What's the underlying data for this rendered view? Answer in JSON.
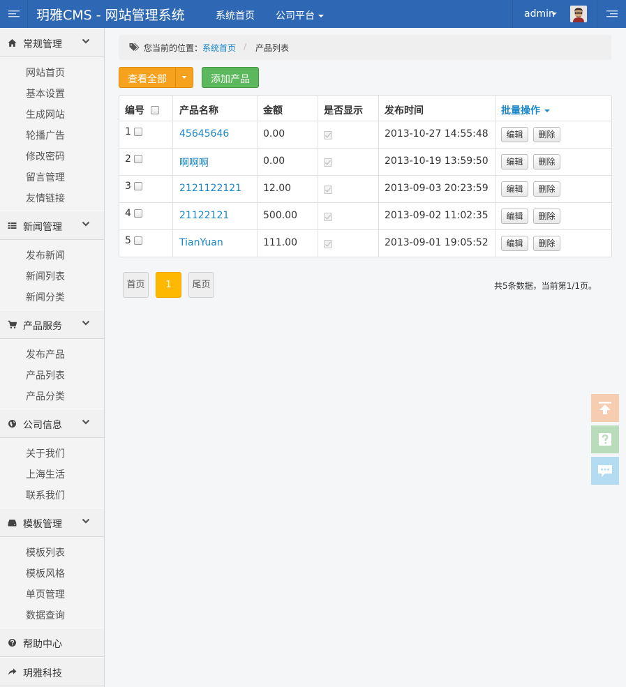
{
  "header": {
    "brand": "玥雅CMS - 网站管理系统",
    "nav_home": "系统首页",
    "nav_company": "公司平台",
    "user_name": "admin"
  },
  "sidebar": {
    "groups": [
      {
        "label": "常规管理",
        "icon": "home-icon",
        "items": [
          "网站首页",
          "基本设置",
          "生成网站",
          "轮播广告",
          "修改密码",
          "留言管理",
          "友情链接"
        ]
      },
      {
        "label": "新闻管理",
        "icon": "list-icon",
        "items": [
          "发布新闻",
          "新闻列表",
          "新闻分类"
        ]
      },
      {
        "label": "产品服务",
        "icon": "cart-icon",
        "items": [
          "发布产品",
          "产品列表",
          "产品分类"
        ]
      },
      {
        "label": "公司信息",
        "icon": "globe-icon",
        "items": [
          "关于我们",
          "上海生活",
          "联系我们"
        ]
      },
      {
        "label": "模板管理",
        "icon": "hdd-icon",
        "items": [
          "模板列表",
          "模板风格",
          "单页管理",
          "数据查询"
        ]
      },
      {
        "label": "帮助中心",
        "icon": "question-icon",
        "items": []
      },
      {
        "label": "玥雅科技",
        "icon": "share-icon",
        "items": []
      }
    ]
  },
  "breadcrumb": {
    "lead": "您当前的位置：",
    "home": "系统首页",
    "separator": "/",
    "current": "产品列表"
  },
  "toolbar": {
    "view_all": "查看全部",
    "add_product": "添加产品"
  },
  "table": {
    "headers": {
      "id": "编号",
      "name": "产品名称",
      "amount": "金额",
      "visible": "是否显示",
      "time": "发布时间",
      "batch": "批量操作"
    },
    "rows": [
      {
        "id": "1",
        "name": "45645646",
        "amount": "0.00",
        "visible": true,
        "time": "2013-10-27 14:55:48",
        "edit": "编辑",
        "delete": "删除"
      },
      {
        "id": "2",
        "name": "啊啊啊",
        "amount": "0.00",
        "visible": true,
        "time": "2013-10-19 13:59:50",
        "edit": "编辑",
        "delete": "删除"
      },
      {
        "id": "3",
        "name": "2121122121",
        "amount": "12.00",
        "visible": true,
        "time": "2013-09-03 20:23:59",
        "edit": "编辑",
        "delete": "删除"
      },
      {
        "id": "4",
        "name": "21122121",
        "amount": "500.00",
        "visible": true,
        "time": "2013-09-02 11:02:35",
        "edit": "编辑",
        "delete": "删除"
      },
      {
        "id": "5",
        "name": "TianYuan",
        "amount": "111.00",
        "visible": true,
        "time": "2013-09-01 19:05:52",
        "edit": "编辑",
        "delete": "删除"
      }
    ]
  },
  "pagination": {
    "first": "首页",
    "current": "1",
    "last": "尾页",
    "info": "共5条数据，当前第1/1页。"
  },
  "colors": {
    "header_bg": "#2e68b5",
    "link": "#1a87c9",
    "orange_button": "#f7a21f",
    "green_button": "#5cb85c",
    "page_active": "#ffb800"
  }
}
